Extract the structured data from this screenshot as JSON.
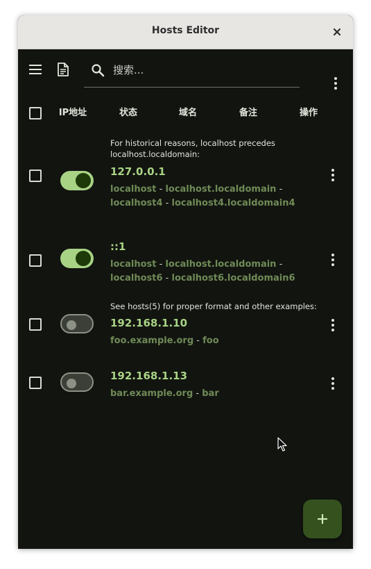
{
  "window": {
    "title": "Hosts Editor"
  },
  "toolbar": {
    "search_placeholder": "搜索..."
  },
  "columns": [
    "IP地址",
    "状态",
    "域名",
    "备注",
    "操作"
  ],
  "entries": [
    {
      "comment": "For historical reasons, localhost precedes localhost.localdomain:",
      "ip": "127.0.0.1",
      "enabled": true,
      "hostnames": [
        "localhost",
        "localhost.localdomain",
        "localhost4",
        "localhost4.localdomain4"
      ]
    },
    {
      "comment": "",
      "ip": "::1",
      "enabled": true,
      "hostnames": [
        "localhost",
        "localhost.localdomain",
        "localhost6",
        "localhost6.localdomain6"
      ]
    },
    {
      "comment": "See hosts(5) for proper format and other examples:",
      "ip": "192.168.1.10",
      "enabled": false,
      "hostnames": [
        "foo.example.org",
        "foo"
      ]
    },
    {
      "comment": "",
      "ip": "192.168.1.13",
      "enabled": false,
      "hostnames": [
        "bar.example.org",
        "bar"
      ]
    }
  ],
  "separator": " - ",
  "icons": {
    "menu": "hamburger-menu-icon",
    "file": "document-icon",
    "search": "search-icon",
    "overflow": "more-vertical-icon",
    "close": "close-icon",
    "add": "plus-icon"
  },
  "colors": {
    "background": "#121410",
    "accent": "#a8d384",
    "hostname": "#6f8a56",
    "fab": "#34511e"
  }
}
